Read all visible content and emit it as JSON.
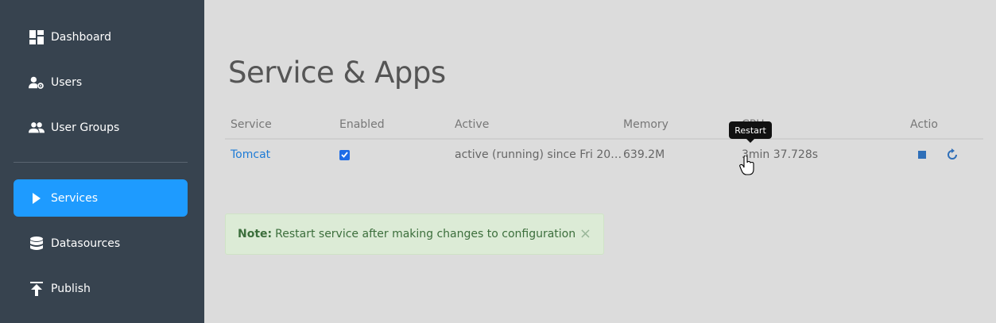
{
  "sidebar": {
    "items": [
      {
        "label": "Dashboard",
        "icon": "dashboard-icon"
      },
      {
        "label": "Users",
        "icon": "user-gear-icon"
      },
      {
        "label": "User Groups",
        "icon": "users-icon"
      },
      {
        "label": "Services",
        "icon": "play-icon",
        "active": true
      },
      {
        "label": "Datasources",
        "icon": "database-icon"
      },
      {
        "label": "Publish",
        "icon": "upload-icon"
      }
    ]
  },
  "main": {
    "title": "Service & Apps",
    "table": {
      "headers": [
        "Service",
        "Enabled",
        "Active",
        "Memory",
        "CPU",
        "Actio"
      ],
      "rows": [
        {
          "service": "Tomcat",
          "enabled": true,
          "active": "active (running) since Fri 20…",
          "memory": "639.2M",
          "cpu": "3min 37.728s"
        }
      ]
    },
    "tooltip": "Restart",
    "alert": {
      "prefix": "Note:",
      "text": "Restart service after making changes to configuration",
      "close": "×"
    }
  },
  "colors": {
    "sidebar_bg": "#37434f",
    "accent": "#1e9bff",
    "link": "#1e7bd6",
    "alert_bg": "#dcebd6"
  }
}
